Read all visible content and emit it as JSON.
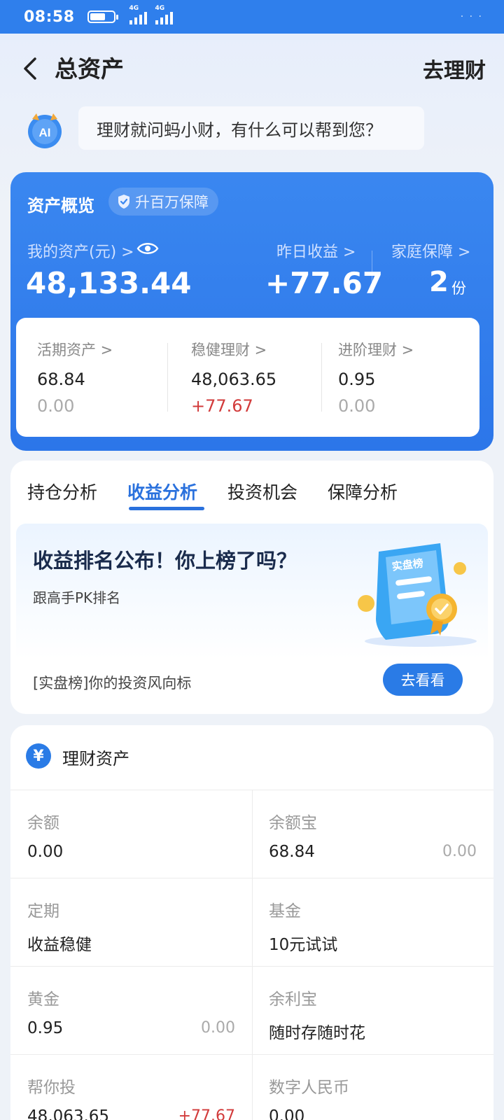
{
  "status": {
    "time": "08:58",
    "net1": "4G",
    "net2": "4G"
  },
  "header": {
    "title": "总资产",
    "action": "去理财"
  },
  "assistant": {
    "icon": "AI",
    "prompt": "理财就问蚂小财，有什么可以帮到您？"
  },
  "overview": {
    "title": "资产概览",
    "badge": "升百万保障",
    "my_assets_label": "我的资产(元) >",
    "my_assets_value": "48,133.44",
    "yesterday_label": "昨日收益 >",
    "yesterday_value": "+77.67",
    "family_label": "家庭保障 >",
    "family_value": "2",
    "family_unit": "份",
    "sub": [
      {
        "label": "活期资产 >",
        "v1": "68.84",
        "v2": "0.00",
        "v2_color": "gray"
      },
      {
        "label": "稳健理财 >",
        "v1": "48,063.65",
        "v2": "+77.67",
        "v2_color": "red"
      },
      {
        "label": "进阶理财 >",
        "v1": "0.95",
        "v2": "0.00",
        "v2_color": "gray"
      }
    ]
  },
  "tabs": [
    "持仓分析",
    "收益分析",
    "投资机会",
    "保障分析"
  ],
  "active_tab": 1,
  "promo": {
    "title": "收益排名公布！你上榜了吗？",
    "subtitle": "跟高手PK排名",
    "footer": "[实盘榜]你的投资风向标",
    "button": "去看看",
    "illustration_text": "实盘榜"
  },
  "assets": {
    "title": "理财资产",
    "cells": [
      {
        "label": "余额",
        "value": "0.00",
        "value2": ""
      },
      {
        "label": "余额宝",
        "value": "68.84",
        "value2": "0.00"
      },
      {
        "label": "定期",
        "value": "收益稳健",
        "value2": ""
      },
      {
        "label": "基金",
        "value": "10元试试",
        "value2": ""
      },
      {
        "label": "黄金",
        "value": "0.95",
        "value2": "0.00"
      },
      {
        "label": "余利宝",
        "value": "随时存随时花",
        "value2": ""
      },
      {
        "label": "帮你投",
        "value": "48,063.65",
        "value2": "+77.67"
      },
      {
        "label": "数字人民币",
        "value": "0.00",
        "value2": ""
      }
    ]
  },
  "colors": {
    "accent": "#2a7be6",
    "card_blue": "#3a87f0",
    "positive_red": "#d23b3b"
  }
}
